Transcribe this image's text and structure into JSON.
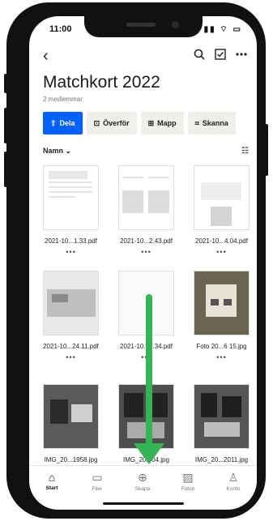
{
  "status": {
    "time": "11:00",
    "icons": "▮▮ ⌔ ▭"
  },
  "header": {
    "back_icon": "chevron-left-icon",
    "title": "Matchkort 2022",
    "subtitle": "2 medlemmar"
  },
  "toolbar": {
    "actions": [
      {
        "label": "Dela",
        "icon": "share-icon"
      },
      {
        "label": "Överför",
        "icon": "upload-icon"
      },
      {
        "label": "Mapp",
        "icon": "folder-add-icon"
      },
      {
        "label": "Skanna",
        "icon": "scan-icon"
      }
    ]
  },
  "sort": {
    "label": "Namn"
  },
  "files": [
    {
      "name": "2021-10...1.33.pdf"
    },
    {
      "name": "2021-10...2.43.pdf"
    },
    {
      "name": "2021-10...4.04.pdf"
    },
    {
      "name": "2021-10...24.11.pdf"
    },
    {
      "name": "2021-10...7.34.pdf"
    },
    {
      "name": "Foto 20...6 15.jpg"
    },
    {
      "name": "IMG_20...1958.jpg"
    },
    {
      "name": "IMG_20...04.jpg"
    },
    {
      "name": "IMG_20...2011.jpg"
    }
  ],
  "more_label": "•••",
  "tabbar": {
    "items": [
      {
        "label": "Start",
        "icon": "home-icon"
      },
      {
        "label": "Filer",
        "icon": "folder-icon"
      },
      {
        "label": "Skapa",
        "icon": "plus-circle-icon"
      },
      {
        "label": "Foton",
        "icon": "photo-icon"
      },
      {
        "label": "Konto",
        "icon": "person-icon"
      }
    ]
  },
  "colors": {
    "primary": "#0061fe",
    "arrow": "#34b554"
  }
}
